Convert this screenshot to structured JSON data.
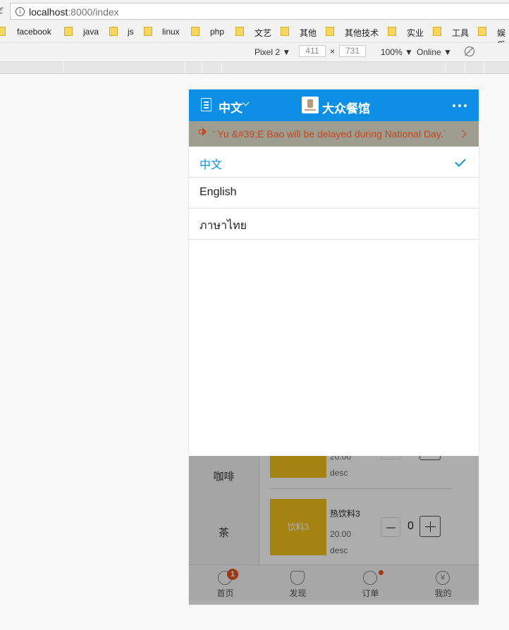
{
  "browser": {
    "url_host": "localhost",
    "url_rest": ":8000/index",
    "bookmarks": [
      "facebook",
      "java",
      "js",
      "linux",
      "php",
      "文艺",
      "其他",
      "其他技术",
      "实业",
      "工具",
      "娱乐"
    ],
    "device": "Pixel 2",
    "width": "411",
    "height": "731",
    "zoom": "100%",
    "network": "Online",
    "times_sign": "×"
  },
  "header": {
    "language": "中文",
    "title": "大众餐馆"
  },
  "notice": {
    "text": "' Yu &#39;E Bao will be delayed during National Day.`"
  },
  "language_menu": {
    "options": [
      "中文",
      "English",
      "ภาษาไทย"
    ],
    "selected": "中文"
  },
  "menu": {
    "categories": [
      "咖啡",
      "茶"
    ],
    "items": [
      {
        "price": "20.00",
        "desc": "desc"
      },
      {
        "thumb_label": "饮料3",
        "name": "热饮料3",
        "price": "20.00",
        "desc": "desc",
        "quantity": "0"
      }
    ]
  },
  "tabbar": {
    "tabs": [
      "首页",
      "发现",
      "订单",
      "我的"
    ],
    "home_badge": "1",
    "mine_icon": "¥"
  },
  "colors": {
    "accent": "#0d8fe6",
    "notice_bg": "#9d9d90",
    "notice_text": "#c8451e",
    "badge": "#e8541c",
    "thumb": "#f2c21c"
  }
}
